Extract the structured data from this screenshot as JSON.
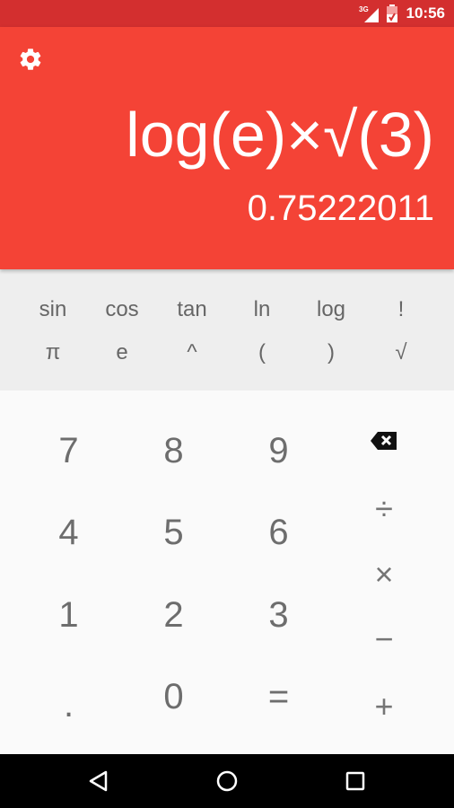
{
  "status_bar": {
    "network": "3G",
    "time": "10:56"
  },
  "display": {
    "settings_icon": "gear-icon",
    "formula": "log(e)×√(3)",
    "result": "0.75222011",
    "color": "#f44336"
  },
  "advanced": {
    "row1": [
      "sin",
      "cos",
      "tan",
      "ln",
      "log",
      "!"
    ],
    "row2": [
      "π",
      "e",
      "^",
      "(",
      ")",
      "√"
    ]
  },
  "numpad": {
    "rows": [
      [
        "7",
        "8",
        "9"
      ],
      [
        "4",
        "5",
        "6"
      ],
      [
        "1",
        "2",
        "3"
      ],
      [
        ".",
        "0",
        "="
      ]
    ]
  },
  "operators": {
    "delete_icon": "backspace-icon",
    "divide": "÷",
    "multiply": "×",
    "minus": "−",
    "plus": "+"
  },
  "nav_bar": {
    "back": "back-icon",
    "home": "home-icon",
    "recents": "recents-icon"
  }
}
